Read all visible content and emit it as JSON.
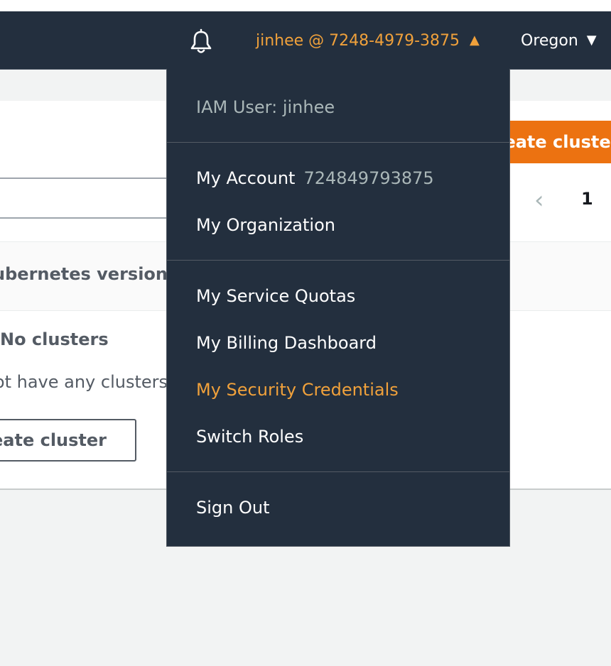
{
  "navbar": {
    "account_label": "jinhee @ 7248-4979-3875",
    "account_caret": "▲",
    "region_label": "Oregon",
    "region_caret": "▼",
    "bell_icon": "bell-icon"
  },
  "background_page": {
    "primary_button_label": "Create cluster",
    "pager_page": "1",
    "column_header": "Kubernetes version",
    "empty_title": "No clusters",
    "empty_description": "You do not have any clusters",
    "secondary_button_label": "Create cluster"
  },
  "dropdown": {
    "iam_user": "IAM User: jinhee",
    "my_account_label": "My Account",
    "my_account_number": "724849793875",
    "my_organization": "My Organization",
    "my_service_quotas": "My Service Quotas",
    "my_billing_dashboard": "My Billing Dashboard",
    "my_security_credentials": "My Security Credentials",
    "switch_roles": "Switch Roles",
    "sign_out": "Sign Out"
  },
  "colors": {
    "navbar_bg": "#232f3e",
    "accent_orange": "#f0a13b",
    "primary_button": "#ec7211"
  }
}
